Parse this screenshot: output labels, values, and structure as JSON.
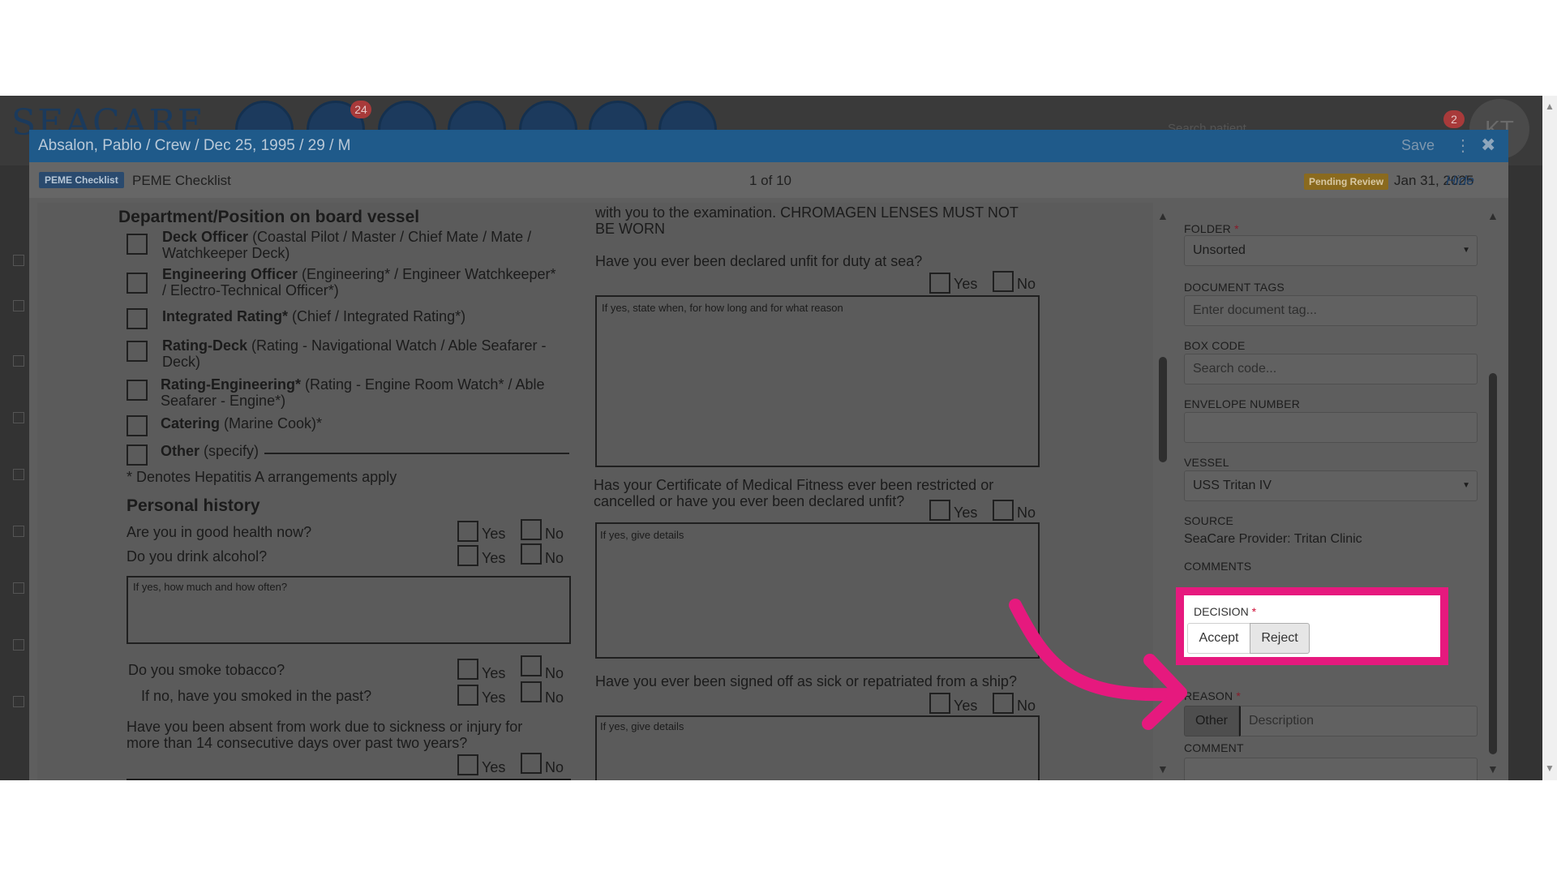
{
  "app": {
    "logo_text": "SEACARE",
    "badges": [
      "24",
      "2"
    ],
    "search_placeholder": "Search patient",
    "avatar_initials": "KT"
  },
  "modal": {
    "title": "Absalon, Pablo / Crew / Dec 25, 1995 / 29 / M",
    "save_label": "Save",
    "doc_type_badge": "PEME Checklist",
    "doc_type_label": "PEME Checklist",
    "page_counter": "1 of 10",
    "status_badge": "Pending Review",
    "doc_date": "Jan 31, 2025",
    "hide_label": "Hide"
  },
  "document": {
    "dept_heading": "Department/Position on board vessel",
    "positions": [
      {
        "title": "Deck Officer",
        "detail": " (Coastal Pilot / Master / Chief Mate / Mate /",
        "detail2": "Watchkeeper Deck)"
      },
      {
        "title": "Engineering Officer",
        "detail": " (Engineering* / Engineer Watchkeeper*",
        "detail2": "/ Electro-Technical Officer*)"
      },
      {
        "title": "Integrated Rating*",
        "detail": " (Chief / Integrated Rating*)",
        "detail2": ""
      },
      {
        "title": "Rating-Deck",
        "detail": " (Rating - Navigational Watch / Able Seafarer -",
        "detail2": "Deck)"
      },
      {
        "title": "Rating-Engineering*",
        "detail": " (Rating - Engine Room Watch* / Able",
        "detail2": "Seafarer - Engine*)"
      },
      {
        "title": "Catering",
        "detail": " (Marine Cook)*",
        "detail2": ""
      },
      {
        "title": "Other",
        "detail": " (specify)",
        "detail2": ""
      }
    ],
    "hepatitis_note": "* Denotes Hepatitis A arrangements apply",
    "personal_heading": "Personal history",
    "q_health": "Are you in good health now?",
    "q_alcohol": "Do you drink alcohol?",
    "alcohol_box_label": "If yes, how much and how often?",
    "q_tobacco": "Do you smoke tobacco?",
    "q_smoked_past": "If no, have you smoked in the past?",
    "q_absent_1": "Have you been absent from work due to sickness or injury for",
    "q_absent_2": "more than 14 consecutive days over past two years?",
    "lens_text_1": "with you to the examination. CHROMAGEN LENSES MUST NOT",
    "lens_text_2": "BE WORN",
    "q_unfit": "Have you ever been declared unfit for duty at sea?",
    "unfit_box_label": "If yes, state when, for how long and for what reason",
    "q_certificate_1": "Has your Certificate of Medical Fitness ever been restricted or",
    "q_certificate_2": "cancelled or have you ever been declared unfit?",
    "details_label": "If yes, give details",
    "q_signed_off": "Have you ever been signed off as sick or repatriated from a ship?",
    "yes": "Yes",
    "no": "No"
  },
  "panel": {
    "folder_label": "Folder",
    "folder_value": "Unsorted",
    "tags_label": "Document Tags",
    "tags_placeholder": "Enter document tag...",
    "box_code_label": "Box Code",
    "box_code_placeholder": "Search code...",
    "envelope_label": "Envelope Number",
    "vessel_label": "Vessel",
    "vessel_value": "USS Tritan IV",
    "source_label": "Source",
    "source_value": "SeaCare Provider: Tritan Clinic",
    "comments_label": "Comments",
    "decision_label": "Decision",
    "accept_label": "Accept",
    "reject_label": "Reject",
    "reason_label": "Reason",
    "reason_other": "Other",
    "reason_placeholder": "Description",
    "comment_label": "Comment",
    "required_mark": "*"
  },
  "colors": {
    "highlight": "#e6197e",
    "header": "#1f5a8a",
    "overlay": "#5e5e5e"
  }
}
